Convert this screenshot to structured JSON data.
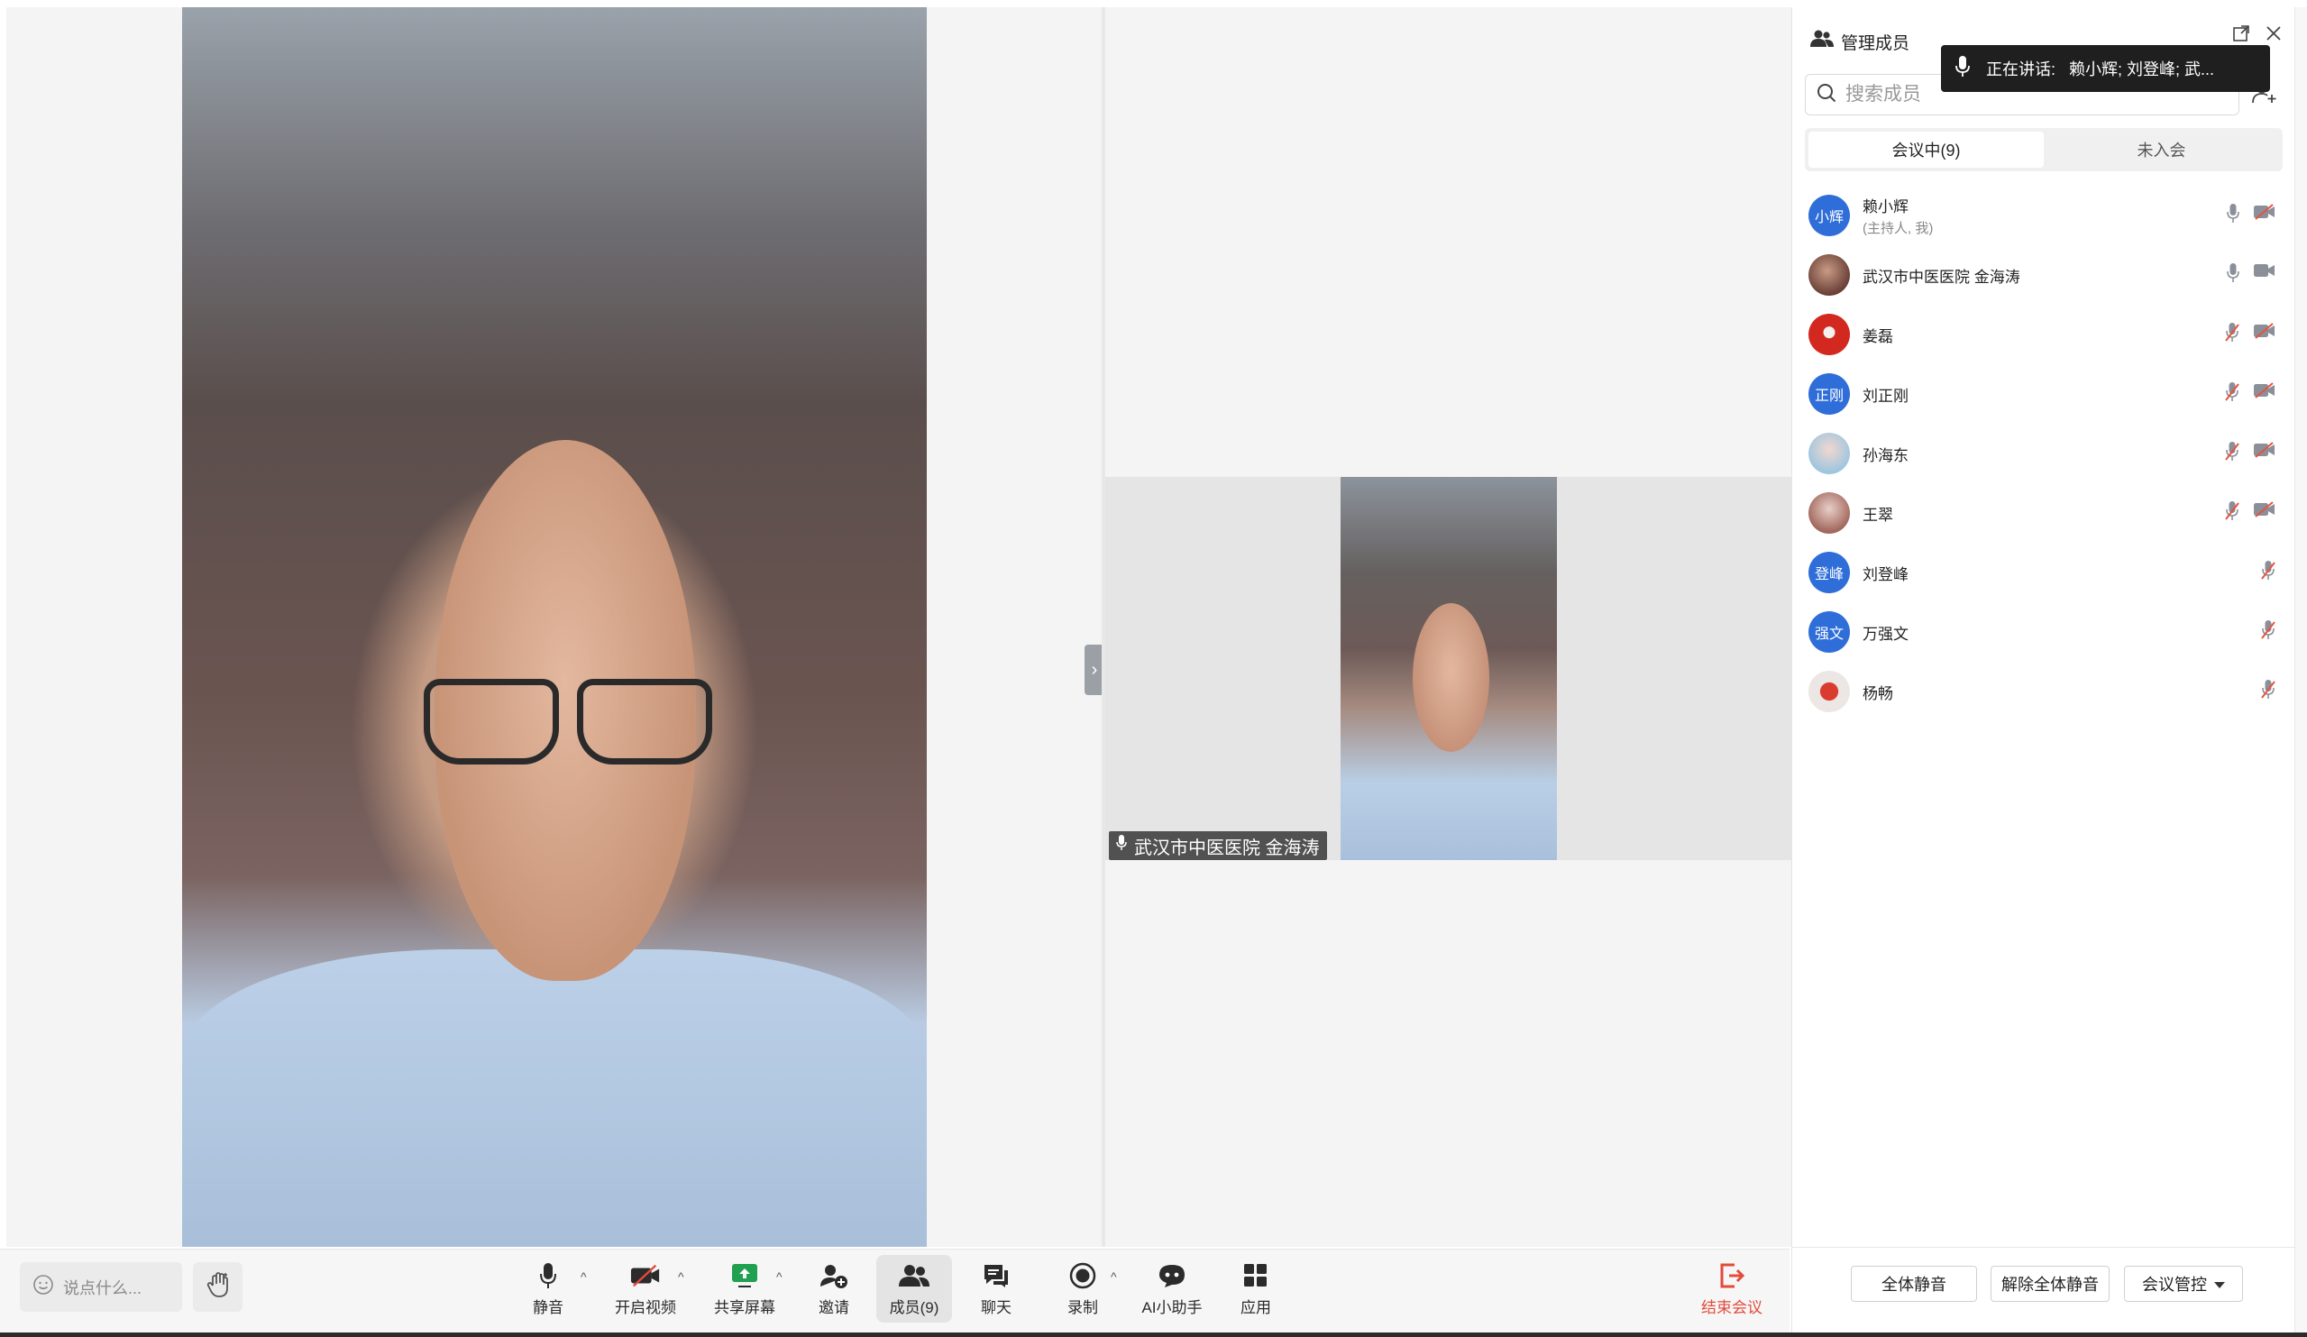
{
  "stage": {
    "thumbnail_name_tag": "武汉市中医医院  金海涛"
  },
  "toolbar": {
    "say_placeholder": "说点什么...",
    "mute_label": "静音",
    "video_label": "开启视频",
    "share_label": "共享屏幕",
    "invite_label": "邀请",
    "members_label": "成员(9)",
    "chat_label": "聊天",
    "record_label": "录制",
    "ai_label": "AI小助手",
    "apps_label": "应用",
    "end_label": "结束会议"
  },
  "panel": {
    "title": "管理成员",
    "speaking_prefix": "正在讲话:",
    "speaking_names": "赖小辉; 刘登峰; 武...",
    "search_placeholder": "搜索成员",
    "tab_in_meeting": "会议中(9)",
    "tab_not_joined": "未入会",
    "members": [
      {
        "name": "赖小辉",
        "sub": "(主持人, 我)",
        "avatar_text": "小辉",
        "mic": "mic-on",
        "cam": "camera-off"
      },
      {
        "name": "武汉市中医医院  金海涛",
        "sub": "",
        "avatar_text": "",
        "mic": "mic-on",
        "cam": "camera-on"
      },
      {
        "name": "姜磊",
        "sub": "",
        "avatar_text": "",
        "mic": "mic-off",
        "cam": "camera-off"
      },
      {
        "name": "刘正刚",
        "sub": "",
        "avatar_text": "正刚",
        "mic": "mic-off",
        "cam": "camera-off"
      },
      {
        "name": "孙海东",
        "sub": "",
        "avatar_text": "",
        "mic": "mic-off",
        "cam": "camera-off"
      },
      {
        "name": "王翠",
        "sub": "",
        "avatar_text": "",
        "mic": "mic-off",
        "cam": "camera-off"
      },
      {
        "name": "刘登峰",
        "sub": "",
        "avatar_text": "登峰",
        "mic": "mic-off",
        "cam": ""
      },
      {
        "name": "万强文",
        "sub": "",
        "avatar_text": "强文",
        "mic": "mic-off",
        "cam": ""
      },
      {
        "name": "杨畅",
        "sub": "",
        "avatar_text": "",
        "mic": "mic-off",
        "cam": ""
      }
    ],
    "footer": {
      "mute_all": "全体静音",
      "unmute_all": "解除全体静音",
      "meeting_control": "会议管控"
    }
  },
  "colors": {
    "accent_blue": "#2f6ed8",
    "end_red": "#e34b3a",
    "muted_red": "#e5533f"
  }
}
